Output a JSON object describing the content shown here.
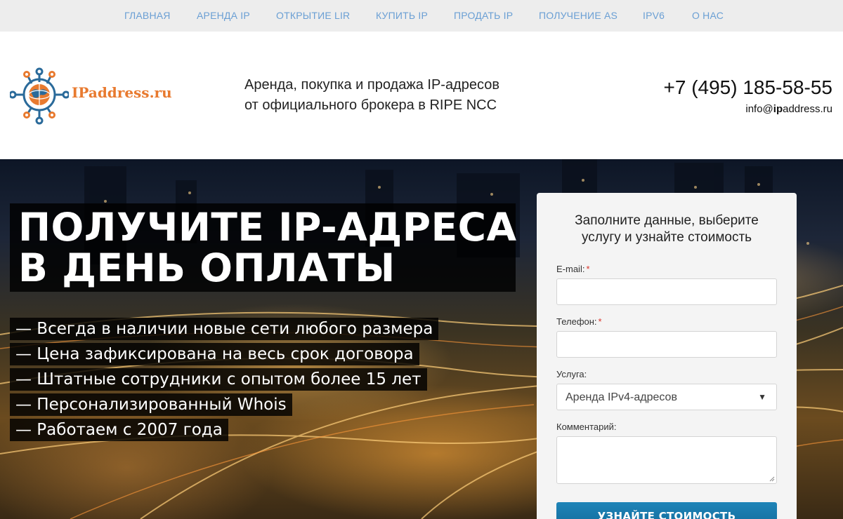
{
  "nav": {
    "items": [
      {
        "label": "ГЛАВНАЯ"
      },
      {
        "label": "АРЕНДА IP"
      },
      {
        "label": "ОТКРЫТИЕ LIR"
      },
      {
        "label": "КУПИТЬ IP"
      },
      {
        "label": "ПРОДАТЬ IP"
      },
      {
        "label": "ПОЛУЧЕНИЕ AS"
      },
      {
        "label": "IPV6"
      },
      {
        "label": "О НАС"
      }
    ]
  },
  "header": {
    "logo_text": "IPaddress.ru",
    "tagline_line1": "Аренда, покупка и продажа IP-адресов",
    "tagline_line2": "от официального брокера в RIPE NCC",
    "phone": "+7 (495) 185-58-55",
    "email_prefix": "info@",
    "email_bold": "ip",
    "email_suffix": "address.ru"
  },
  "hero": {
    "title_line1": "ПОЛУЧИТЕ IP-АДРЕСА",
    "title_line2": "В ДЕНЬ ОПЛАТЫ",
    "features": [
      "— Всегда в наличии новые сети любого размера",
      "— Цена зафиксирована на весь срок договора",
      "— Штатные сотрудники с опытом более 15 лет",
      "— Персонализированный Whois",
      "— Работаем с 2007 года"
    ]
  },
  "form": {
    "title_line1": "Заполните данные, выберите",
    "title_line2": "услугу и узнайте стоимость",
    "email_label": "E-mail:",
    "phone_label": "Телефон:",
    "required_mark": "*",
    "service_label": "Услуга:",
    "service_value": "Аренда IPv4-адресов",
    "comment_label": "Комментарий:",
    "submit_label": "Узнайте стоимость"
  },
  "colors": {
    "nav_link": "#6a9fd4",
    "logo_orange": "#e87a2f",
    "logo_blue": "#2a6a9a",
    "button_blue": "#1a78aa"
  },
  "icons": {
    "logo_icon": "network-globe-icon",
    "select_arrow": "triangle-down-icon"
  }
}
